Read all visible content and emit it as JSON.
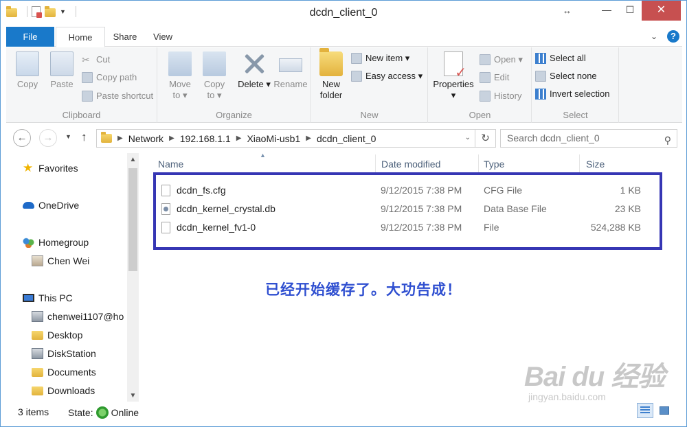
{
  "window": {
    "title": "dcdn_client_0",
    "minimize_icon": "minimize-icon",
    "maximize_icon": "maximize-icon",
    "close_icon": "close-icon"
  },
  "tabs": [
    {
      "label": "File"
    },
    {
      "label": "Home"
    },
    {
      "label": "Share"
    },
    {
      "label": "View"
    }
  ],
  "ribbon": {
    "clipboard": {
      "group_label": "Clipboard",
      "copy": "Copy",
      "paste": "Paste",
      "cut": "Cut",
      "copy_path": "Copy path",
      "paste_shortcut": "Paste shortcut"
    },
    "organize": {
      "group_label": "Organize",
      "move_to": "Move to ▾",
      "copy_to": "Copy to ▾",
      "delete": "Delete ▾",
      "rename": "Rename"
    },
    "new": {
      "group_label": "New",
      "new_folder": "New folder",
      "new_item": "New item ▾",
      "easy_access": "Easy access ▾"
    },
    "open": {
      "group_label": "Open",
      "properties": "Properties ▾",
      "open": "Open ▾",
      "edit": "Edit",
      "history": "History"
    },
    "select": {
      "group_label": "Select",
      "select_all": "Select all",
      "select_none": "Select none",
      "invert_selection": "Invert selection"
    }
  },
  "address": {
    "breadcrumbs": [
      "Network",
      "192.168.1.1",
      "XiaoMi-usb1",
      "dcdn_client_0"
    ],
    "search_placeholder": "Search dcdn_client_0"
  },
  "nav": {
    "favorites": "Favorites",
    "onedrive": "OneDrive",
    "homegroup": "Homegroup",
    "homegroup_user": "Chen Wei",
    "this_pc": "This PC",
    "pc_items": [
      "chenwei1107@ho",
      "Desktop",
      "DiskStation",
      "Documents",
      "Downloads"
    ]
  },
  "file_list": {
    "columns": {
      "name": "Name",
      "date": "Date modified",
      "type": "Type",
      "size": "Size"
    },
    "rows": [
      {
        "name": "dcdn_fs.cfg",
        "date": "9/12/2015 7:38 PM",
        "type": "CFG File",
        "size": "1 KB"
      },
      {
        "name": "dcdn_kernel_crystal.db",
        "date": "9/12/2015 7:38 PM",
        "type": "Data Base File",
        "size": "23 KB"
      },
      {
        "name": "dcdn_kernel_fv1-0",
        "date": "9/12/2015 7:38 PM",
        "type": "File",
        "size": "524,288 KB"
      }
    ]
  },
  "annotation": {
    "text": "已经开始缓存了。大功告成！",
    "color": "#2f4fd0",
    "box_color": "#3636b4"
  },
  "status": {
    "items_count": "3 items",
    "state_label": "State:",
    "state_value": "Online"
  },
  "watermark": {
    "logo": "Bai du 经验",
    "url": "jingyan.baidu.com"
  }
}
